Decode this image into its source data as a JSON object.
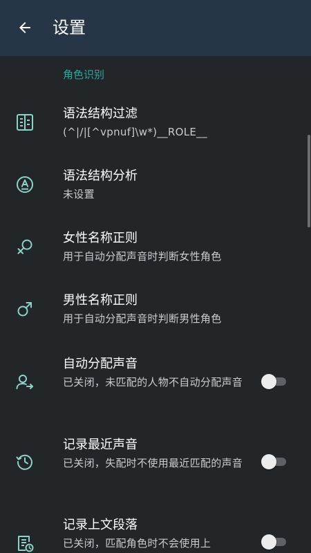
{
  "appbar": {
    "title": "设置",
    "back_icon": "arrow-back-icon"
  },
  "section": {
    "header": "角色识别"
  },
  "preferences": [
    {
      "icon": "filter-list-icon",
      "title": "语法结构过滤",
      "summary": "(^|/|[^vpnuf]\\w*)__ROLE__"
    },
    {
      "icon": "grammar-analysis-icon",
      "title": "语法结构分析",
      "summary": "未设置"
    },
    {
      "icon": "female-icon",
      "title": "女性名称正则",
      "summary": "用于自动分配声音时判断女性角色"
    },
    {
      "icon": "male-icon",
      "title": "男性名称正则",
      "summary": "用于自动分配声音时判断男性角色"
    },
    {
      "icon": "person-assign-icon",
      "title": "自动分配声音",
      "summary": "已关闭，未匹配的人物不自动分配声音",
      "switch_on": false
    },
    {
      "icon": "history-icon",
      "title": "记录最近声音",
      "summary": "已关闭，失配时不使用最近匹配的声音",
      "switch_on": false
    },
    {
      "icon": "document-history-icon",
      "title": "记录上文段落",
      "summary": "已关闭，匹配角色时不会使用上",
      "switch_on": false
    }
  ],
  "colors": {
    "appbar": "#263647",
    "background": "#222629",
    "accent": "#2aa89a",
    "icon": "#8fd3c8"
  }
}
